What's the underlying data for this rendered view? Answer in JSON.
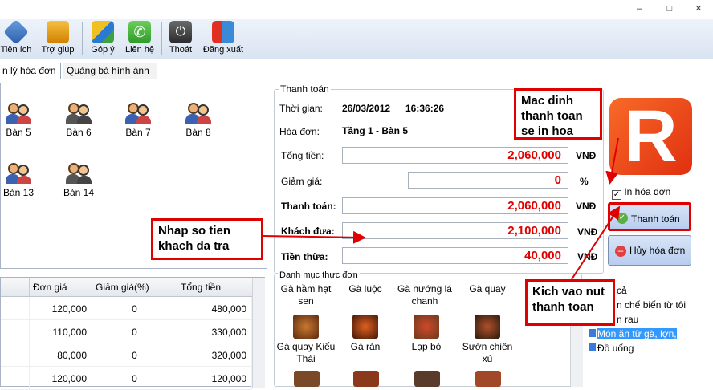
{
  "toolbar": {
    "tien_ich": "Tiện ích",
    "tro_giup": "Trợ giúp",
    "gop_y": "Góp ý",
    "lien_he": "Liên hệ",
    "thoat": "Thoát",
    "dang_xuat": "Đăng xuất"
  },
  "tabs": {
    "quan_ly_hoa_don": "n lý hóa đơn",
    "quang_ba": "Quảng bá hình ảnh"
  },
  "tables": [
    "Bàn 5",
    "Bàn 6",
    "Bàn 7",
    "Bàn 8",
    "Bàn 13",
    "Bàn 14"
  ],
  "grid": {
    "headers": [
      "Đơn giá",
      "Giảm giá(%)",
      "Tổng tiền"
    ],
    "rows": [
      [
        "120,000",
        "0",
        "480,000"
      ],
      [
        "110,000",
        "0",
        "330,000"
      ],
      [
        "80,000",
        "0",
        "320,000"
      ],
      [
        "120,000",
        "0",
        "120,000"
      ]
    ]
  },
  "payment": {
    "group_title": "Thanh toán",
    "time_label": "Thời gian:",
    "date": "26/03/2012",
    "time": "16:36:26",
    "invoice_label": "Hóa đơn:",
    "invoice": "Tầng 1 - Bàn 5",
    "total_label": "Tổng tiền:",
    "total": "2,060,000",
    "total_unit": "VNĐ",
    "discount_label": "Giảm giá:",
    "discount": "0",
    "discount_unit": "%",
    "pay_label": "Thanh toán:",
    "pay": "2,060,000",
    "pay_unit": "VNĐ",
    "given_label": "Khách đưa:",
    "given": "2,100,000",
    "given_unit": "VNĐ",
    "change_label": "Tiền thừa:",
    "change": "40,000",
    "change_unit": "VNĐ"
  },
  "menu": {
    "group_title": "Danh mục thực đơn",
    "dishes_top": [
      "Gà hầm hạt sen",
      "Gà luộc",
      "Gà nướng lá chanh",
      "Gà quay"
    ],
    "dishes": [
      "Gà quay Kiểu Thái",
      "Gà rán",
      "Lạp bò",
      "Sườn chiên xù"
    ]
  },
  "categories": [
    "cả",
    "n chế biến từ tôi",
    "n rau",
    "Món ăn từ gà, lợn,",
    "Đồ uống"
  ],
  "actions": {
    "print_invoice": "In hóa đơn",
    "pay_button": "Thanh toán",
    "cancel_button": "Hủy hóa đơn"
  },
  "logo": {
    "letter": "R"
  },
  "callouts": {
    "default_print": "Mac dinh thanh toan se in hoa",
    "enter_amount": "Nhap so tien khach da tra",
    "click_pay": "Kich vao nut thanh toan"
  },
  "colors": {
    "amount": "#e00000",
    "callout_border": "#e00000",
    "logo": "#f06020",
    "selected_category": "#3399ff"
  }
}
